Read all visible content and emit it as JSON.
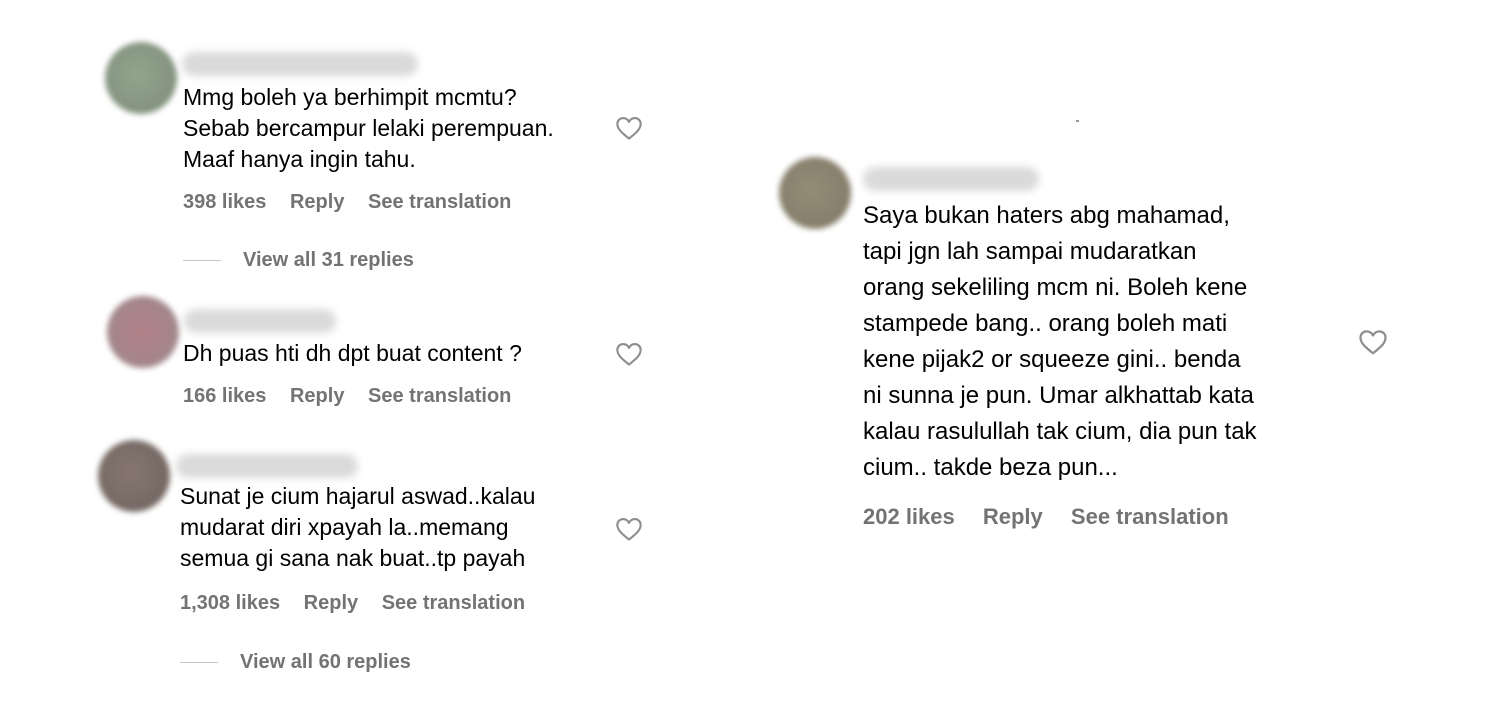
{
  "comments": [
    {
      "lines": [
        "Mmg boleh ya berhimpit mcmtu?",
        "Sebab bercampur lelaki perempuan.",
        "Maaf hanya ingin tahu."
      ],
      "likes": "398 likes",
      "reply": "Reply",
      "translate": "See translation",
      "view_replies": "View all 31 replies",
      "avatar_color": "#8a9a85"
    },
    {
      "lines": [
        "Dh puas hti dh dpt buat content ?"
      ],
      "likes": "166 likes",
      "reply": "Reply",
      "translate": "See translation",
      "avatar_color": "#a88085"
    },
    {
      "lines": [
        "Sunat je cium hajarul aswad..kalau",
        "mudarat diri xpayah la..memang",
        "semua gi sana nak buat..tp payah"
      ],
      "likes": "1,308 likes",
      "reply": "Reply",
      "translate": "See translation",
      "view_replies": "View all 60 replies",
      "avatar_color": "#7a6c68"
    },
    {
      "lines": [
        "Saya bukan haters abg mahamad,",
        "tapi jgn lah sampai mudaratkan",
        "orang sekeliling mcm ni. Boleh kene",
        "stampede bang.. orang boleh mati",
        "kene pijak2 or squeeze gini.. benda",
        "ni sunna je pun. Umar alkhattab kata",
        "kalau rasulullah tak cium, dia pun tak",
        "cium.. takde beza pun..."
      ],
      "likes": "202 likes",
      "reply": "Reply",
      "translate": "See translation",
      "avatar_color": "#8c8470"
    }
  ],
  "colors": {
    "text": "#000000",
    "meta": "#737373",
    "heart_stroke": "#8e8e8e"
  },
  "icons": {
    "like": "heart-outline-icon"
  }
}
